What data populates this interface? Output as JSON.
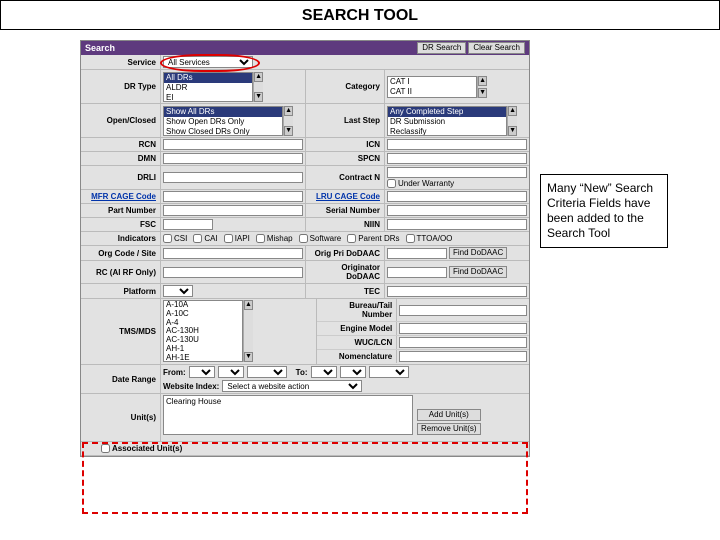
{
  "title": "SEARCH TOOL",
  "callout": "Many “New” Search Criteria Fields have been added to the Search Tool",
  "panel": {
    "title": "Search",
    "buttons": {
      "search": "DR Search",
      "clear": "Clear Search"
    }
  },
  "labels": {
    "service": "Service",
    "dr_type": "DR Type",
    "category": "Category",
    "open_closed": "Open/Closed",
    "last_step": "Last Step",
    "rcn": "RCN",
    "icn": "ICN",
    "dmn": "DMN",
    "spcn": "SPCN",
    "drli": "DRLI",
    "contract_n": "Contract N",
    "mfr_cage": "MFR CAGE Code",
    "lru_cage": "LRU CAGE Code",
    "part_number": "Part Number",
    "serial_number": "Serial Number",
    "fsc": "FSC",
    "niin": "NIIN",
    "indicators": "Indicators",
    "org_code_site": "Org Code / Site",
    "orig_pri_dodaac": "Orig Pri DoDAAC",
    "rc_af_only": "RC (Al RF Only)",
    "originator_dodaac": "Originator DoDAAC",
    "platform": "Platform",
    "tec": "TEC",
    "tms_mds": "TMS/MDS",
    "bureau_tail": "Bureau/Tail Number",
    "engine_model": "Engine Model",
    "wuc_lcn": "WUC/LCN",
    "nomenclature": "Nomenclature",
    "date_range": "Date Range",
    "from": "From:",
    "to": "To:",
    "website": "Website Index:",
    "select_website": "Select a website action",
    "units": "Unit(s)",
    "associated_units": "Associated Unit(s)"
  },
  "service_options": {
    "selected": "All Services"
  },
  "dr_type_options": [
    "All DRs",
    "ALDR",
    "EI"
  ],
  "category_options": [
    "CAT I",
    "CAT II"
  ],
  "open_closed_options": [
    "Show All DRs",
    "Show Open DRs Only",
    "Show Closed DRs Only"
  ],
  "last_step_options": [
    "Any Completed Step",
    "DR Submission",
    "Reclassify"
  ],
  "indicators": {
    "csi": "CSI",
    "cai": "CAI",
    "iapi": "IAPI",
    "mishap": "Mishap",
    "software": "Software",
    "parent_drs": "Parent DRs",
    "ttoa_oo": "TTOA/OO"
  },
  "under_warranty": "Under Warranty",
  "find_dodaac": "Find DoDAAC",
  "tms_options": [
    "A-10A",
    "A-10C",
    "A-4",
    "AC-130H",
    "AC-130U",
    "AH-1",
    "AH-1E"
  ],
  "units_value": "Clearing House",
  "units_buttons": {
    "add": "Add Unit(s)",
    "remove": "Remove Unit(s)"
  }
}
